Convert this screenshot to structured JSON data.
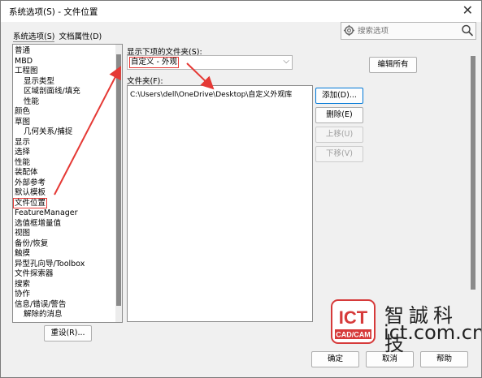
{
  "window": {
    "title": "系统选项(S) - 文件位置"
  },
  "tabs": [
    {
      "label": "系统选项(S)"
    },
    {
      "label": "文档属性(D)"
    }
  ],
  "search": {
    "placeholder": "搜索选项"
  },
  "tree": {
    "items": [
      {
        "label": "普通"
      },
      {
        "label": "MBD"
      },
      {
        "label": "工程图"
      },
      {
        "label": "显示类型"
      },
      {
        "label": "区域剖面线/填充"
      },
      {
        "label": "性能"
      },
      {
        "label": "颜色"
      },
      {
        "label": "草图"
      },
      {
        "label": "几何关系/捕捉"
      },
      {
        "label": "显示"
      },
      {
        "label": "选择"
      },
      {
        "label": "性能"
      },
      {
        "label": "装配体"
      },
      {
        "label": "外部参考"
      },
      {
        "label": "默认模板"
      },
      {
        "label": "文件位置"
      },
      {
        "label": "FeatureManager"
      },
      {
        "label": "选值框增量值"
      },
      {
        "label": "视图"
      },
      {
        "label": "备份/恢复"
      },
      {
        "label": "触摸"
      },
      {
        "label": "异型孔向导/Toolbox"
      },
      {
        "label": "文件探索器"
      },
      {
        "label": "搜索"
      },
      {
        "label": "协作"
      },
      {
        "label": "信息/错误/警告"
      },
      {
        "label": "解除的消息"
      }
    ]
  },
  "folders_for": {
    "label": "显示下项的文件夹(S):",
    "selected": "自定义 - 外观"
  },
  "edit_all_label": "编辑所有",
  "folders": {
    "label": "文件夹(F):",
    "items": [
      "C:\\Users\\dell\\OneDrive\\Desktop\\自定义外观库"
    ]
  },
  "side_buttons": {
    "add": "添加(D)...",
    "delete": "删除(E)",
    "up": "上移(U)",
    "down": "下移(V)"
  },
  "reset_label": "重设(R)...",
  "footer": {
    "ok": "确定",
    "cancel": "取消",
    "help": "帮助"
  },
  "watermark": {
    "logo_text": "ICT",
    "logo_sub": "CAD/CAM",
    "chinese": "智誠科技",
    "url": "ict.com.cn"
  },
  "colors": {
    "annotation": "#e53935",
    "accent": "#0078d7",
    "logo": "#d63a3a"
  }
}
